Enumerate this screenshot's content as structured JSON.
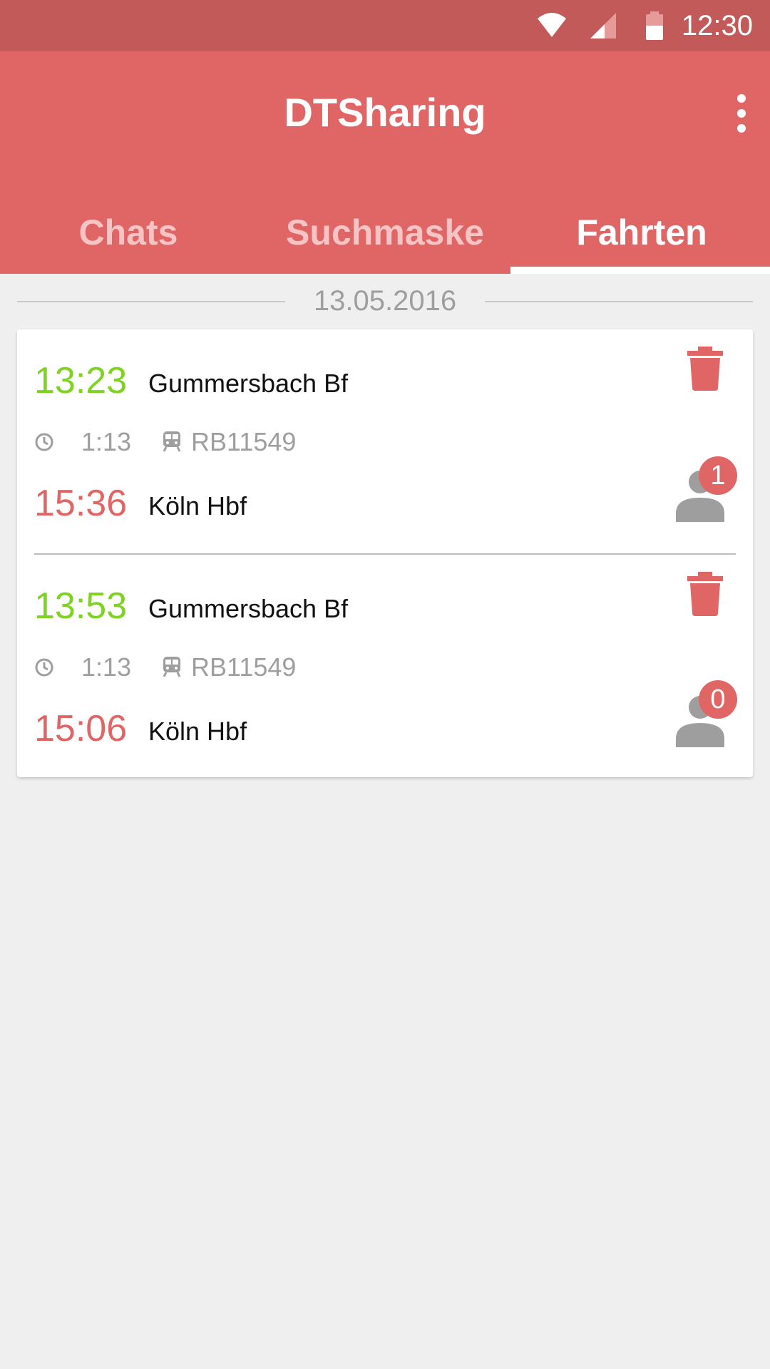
{
  "status_bar": {
    "time": "12:30",
    "icons": [
      "wifi-icon",
      "cell-signal-icon",
      "battery-icon"
    ]
  },
  "app_bar": {
    "title": "DTSharing",
    "menu_icon": "more-vert-icon"
  },
  "tabs": [
    {
      "label": "Chats",
      "active": false
    },
    {
      "label": "Suchmaske",
      "active": false
    },
    {
      "label": "Fahrten",
      "active": true
    }
  ],
  "date_header": "13.05.2016",
  "trips": [
    {
      "departure_time": "13:23",
      "departure_station": "Gummersbach Bf",
      "duration": "1:13",
      "train": "RB11549",
      "arrival_time": "15:36",
      "arrival_station": "Köln Hbf",
      "participants": "1"
    },
    {
      "departure_time": "13:53",
      "departure_station": "Gummersbach Bf",
      "duration": "1:13",
      "train": "RB11549",
      "arrival_time": "15:06",
      "arrival_station": "Köln Hbf",
      "participants": "0"
    }
  ],
  "colors": {
    "primary": "#e06666",
    "status_bar": "#c35a5a",
    "departure": "#7ed321",
    "arrival": "#e06666",
    "muted": "#9e9e9e",
    "background": "#efefef"
  }
}
